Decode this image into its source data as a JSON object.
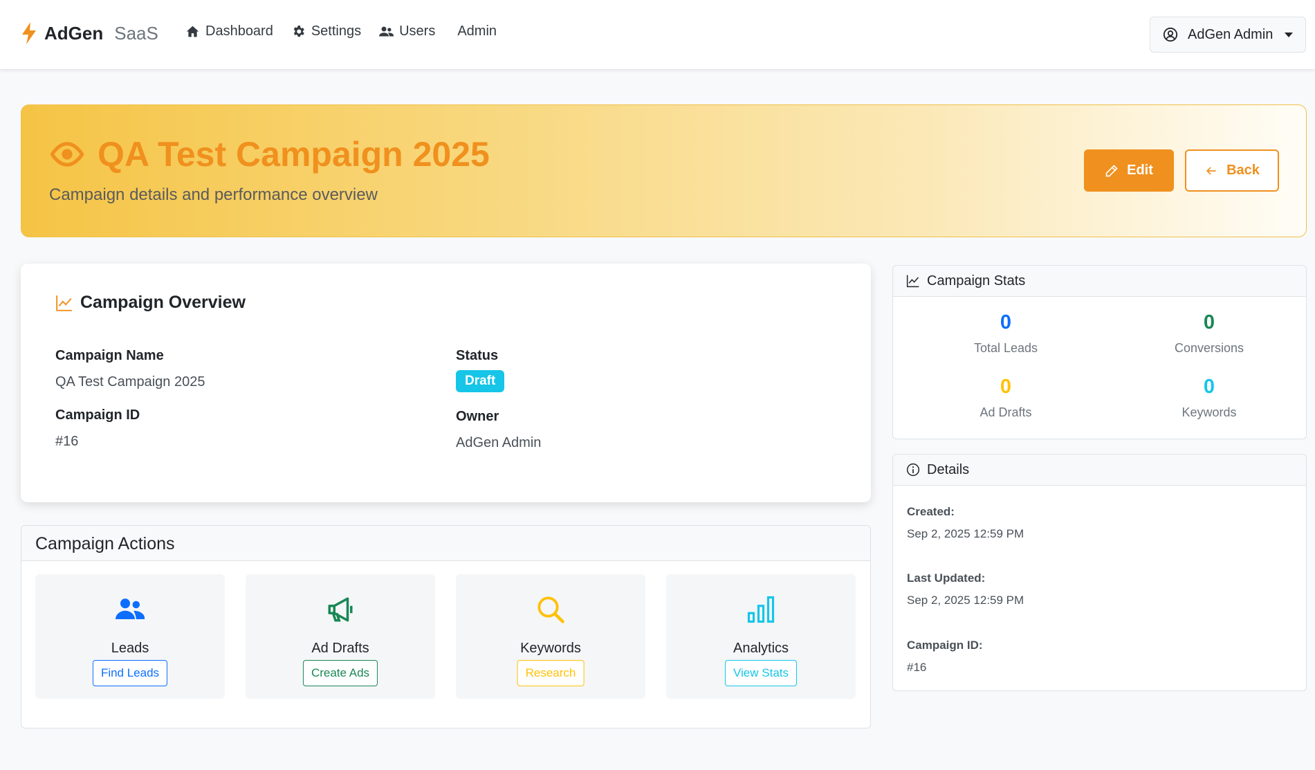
{
  "navbar": {
    "brand_name": "AdGen",
    "brand_suffix": "SaaS",
    "links": [
      "Dashboard",
      "Settings",
      "Users",
      "Admin"
    ],
    "user_menu": "AdGen Admin"
  },
  "hero": {
    "title": "QA Test Campaign 2025",
    "subtitle": "Campaign details and performance overview",
    "edit_label": "Edit",
    "back_label": "Back"
  },
  "overview": {
    "title": "Campaign Overview",
    "campaign_name_label": "Campaign Name",
    "campaign_name": "QA Test Campaign 2025",
    "status_label": "Status",
    "status": "Draft",
    "campaign_id_label": "Campaign ID",
    "campaign_id": "#16",
    "owner_label": "Owner",
    "owner": "AdGen Admin"
  },
  "actions": {
    "title": "Campaign Actions",
    "tiles": [
      {
        "label": "Leads",
        "button": "Find Leads"
      },
      {
        "label": "Ad Drafts",
        "button": "Create Ads"
      },
      {
        "label": "Keywords",
        "button": "Research"
      },
      {
        "label": "Analytics",
        "button": "View Stats"
      }
    ]
  },
  "stats": {
    "title": "Campaign Stats",
    "items": [
      {
        "value": "0",
        "label": "Total Leads"
      },
      {
        "value": "0",
        "label": "Conversions"
      },
      {
        "value": "0",
        "label": "Ad Drafts"
      },
      {
        "value": "0",
        "label": "Keywords"
      }
    ]
  },
  "details": {
    "title": "Details",
    "created_label": "Created:",
    "created": "Sep 2, 2025 12:59 PM",
    "updated_label": "Last Updated:",
    "updated": "Sep 2, 2025 12:59 PM",
    "id_label": "Campaign ID:",
    "id": "#16"
  },
  "colors": {
    "accent": "#f0901e",
    "info": "#16c5e8",
    "primary": "#0d6efd",
    "success": "#198754",
    "warning": "#ffc107"
  }
}
